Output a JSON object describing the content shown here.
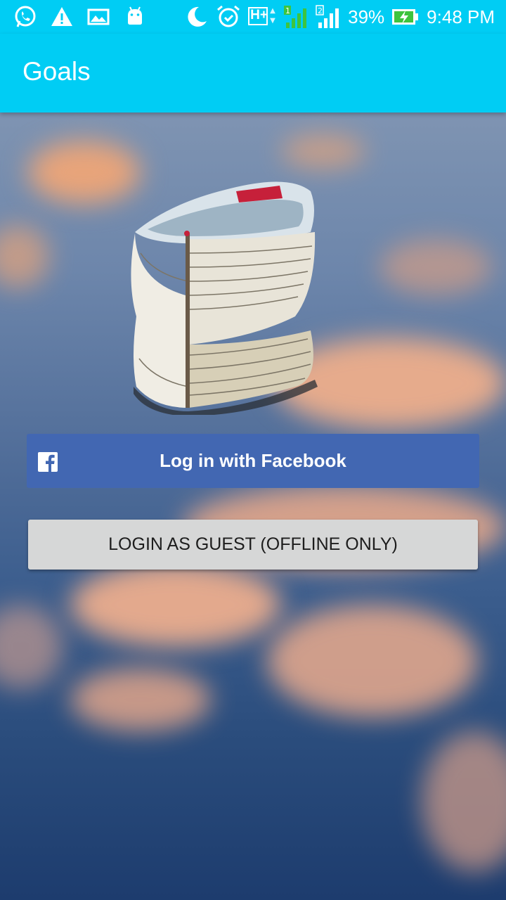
{
  "status_bar": {
    "left_icons": [
      "whatsapp-icon",
      "warning-icon",
      "gallery-icon",
      "android-icon"
    ],
    "right_icons": [
      "moon-icon",
      "alarm-icon",
      "network-hplus-icon",
      "signal-sim1-icon",
      "signal-sim2-icon"
    ],
    "hplus": "H+",
    "battery_percent": "39%",
    "time": "9:48 PM",
    "battery_icon": "battery-charging-icon"
  },
  "app_bar": {
    "title": "Goals"
  },
  "login": {
    "facebook_label": "Log in with Facebook",
    "facebook_icon": "facebook-icon",
    "guest_label": "LOGIN AS GUEST (OFFLINE ONLY)"
  },
  "colors": {
    "app_bar": "#00cdf4",
    "facebook": "#4267b2",
    "guest": "#d6d7d7"
  }
}
